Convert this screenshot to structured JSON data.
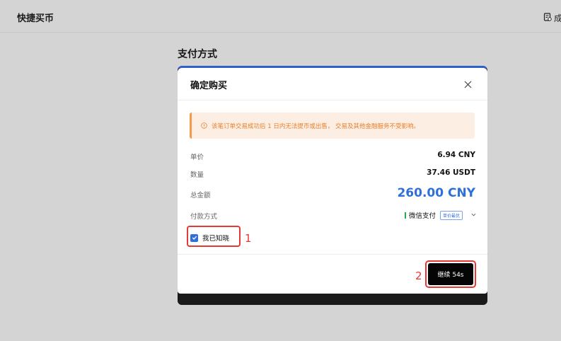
{
  "header": {
    "title": "快捷买币",
    "orders_label": "成"
  },
  "section": {
    "title": "支付方式"
  },
  "modal": {
    "title": "确定购买",
    "notice": "该笔订单交易成功后 1 日内无法提币或出售， 交易及其他金融服务不受影响。",
    "rows": [
      {
        "label": "单价",
        "value": "6.94 CNY"
      },
      {
        "label": "数量",
        "value": "37.46 USDT"
      },
      {
        "label": "总金额",
        "value": "260.00 CNY"
      }
    ],
    "payment": {
      "label": "付款方式",
      "method": "微信支付",
      "badge": "单价最优"
    },
    "acknowledge": {
      "label": "我已知晓",
      "checked": true
    },
    "continue_label": "继续 54s"
  },
  "annotations": {
    "step1": "1",
    "step2": "2"
  },
  "colors": {
    "accent": "#2f6fd8",
    "notice_text": "#e8802c",
    "notice_bg": "#fdeee3",
    "annotation": "#e53935",
    "wechat": "#22b04b"
  }
}
